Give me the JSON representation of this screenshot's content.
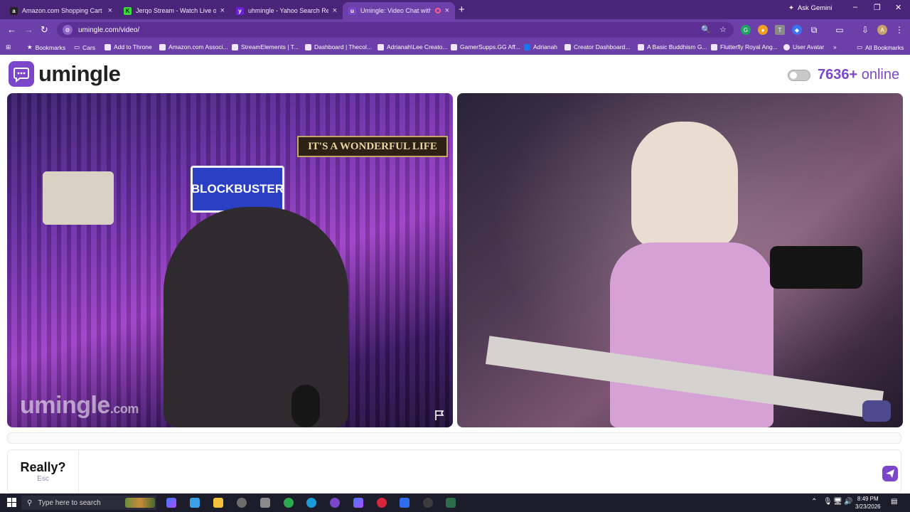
{
  "browser": {
    "tabs": [
      {
        "title": "Amazon.com Shopping Cart",
        "favicon_letter": "a",
        "favicon_color": "#222222",
        "active": false
      },
      {
        "title": "Jerqo Stream - Watch Live on K",
        "favicon_letter": "K",
        "favicon_color": "#3ddc3d",
        "active": false
      },
      {
        "title": "uhmingle - Yahoo Search Result",
        "favicon_letter": "y",
        "favicon_color": "#6d1fd6",
        "active": false
      },
      {
        "title": "Umingle: Video Chat with S",
        "favicon_letter": "u",
        "favicon_color": "#7b46c9",
        "active": true
      }
    ],
    "new_tab": "+",
    "ask_gemini": "Ask Gemini",
    "url": "umingle.com/video/",
    "bookmarks": [
      "Bookmarks",
      "Cars",
      "Add to Throne",
      "Amazon.com Associ...",
      "StreamElements | T...",
      "Dashboard | Thecol...",
      "Adrianah\\Lee Creato...",
      "GamerSupps.GG Aff...",
      "Adrianah",
      "Creator Dashboard...",
      "A Basic Buddhism G...",
      "Flutterfly Royal Ang...",
      "User Avatar"
    ],
    "more_bookmarks": "»",
    "all_bookmarks": "All Bookmarks"
  },
  "page": {
    "logo_text": "umingle",
    "online_count": "7636+",
    "online_label": "online",
    "left_video": {
      "watermark_main": "umingle",
      "watermark_suffix": ".com",
      "sign_text": "BLOCKBUSTER",
      "banner_text": "IT'S A WONDERFUL LIFE"
    },
    "chat": {
      "skip_label": "Really?",
      "skip_hint": "Esc",
      "message_value": "",
      "message_placeholder": ""
    }
  },
  "taskbar": {
    "search_placeholder": "Type here to search",
    "time": "8:49 PM",
    "date": "3/23/2026"
  },
  "colors": {
    "brand": "#7b46c9",
    "tabstrip": "#4a2478",
    "toolbar": "#6d3fa8"
  }
}
